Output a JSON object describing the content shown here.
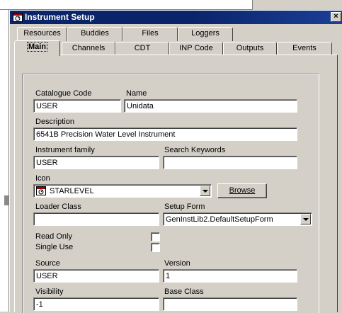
{
  "window": {
    "title": "Instrument Setup",
    "close_glyph": "×"
  },
  "tabs_back": [
    {
      "label": "Resources"
    },
    {
      "label": "Buddies"
    },
    {
      "label": "Files"
    },
    {
      "label": "Loggers"
    }
  ],
  "tabs_front": [
    {
      "label": "Main"
    },
    {
      "label": "Channels"
    },
    {
      "label": "CDT"
    },
    {
      "label": "INP Code"
    },
    {
      "label": "Outputs"
    },
    {
      "label": "Events"
    }
  ],
  "form": {
    "catalogue_code": {
      "label": "Catalogue Code",
      "value": "USER"
    },
    "name": {
      "label": "Name",
      "value": "Unidata"
    },
    "description": {
      "label": "Description",
      "value": "6541B Precision Water Level Instrument"
    },
    "instrument_family": {
      "label": "Instrument family",
      "value": "USER"
    },
    "search_keywords": {
      "label": "Search Keywords",
      "value": ""
    },
    "icon": {
      "label": "Icon",
      "value": "STARLEVEL",
      "icon_name": "starlevel-icon"
    },
    "browse_button": {
      "label": "Browse"
    },
    "loader_class": {
      "label": "Loader Class",
      "value": ""
    },
    "setup_form": {
      "label": "Setup Form",
      "value": "GenInstLib2.DefaultSetupForm"
    },
    "read_only": {
      "label": "Read Only"
    },
    "single_use": {
      "label": "Single Use"
    },
    "source": {
      "label": "Source",
      "value": "USER"
    },
    "version": {
      "label": "Version",
      "value": "1"
    },
    "visibility": {
      "label": "Visibility",
      "value": "-1"
    },
    "base_class": {
      "label": "Base Class",
      "value": ""
    }
  },
  "colors": {
    "titlebar": "#0a246a",
    "face": "#d4d0c8"
  }
}
